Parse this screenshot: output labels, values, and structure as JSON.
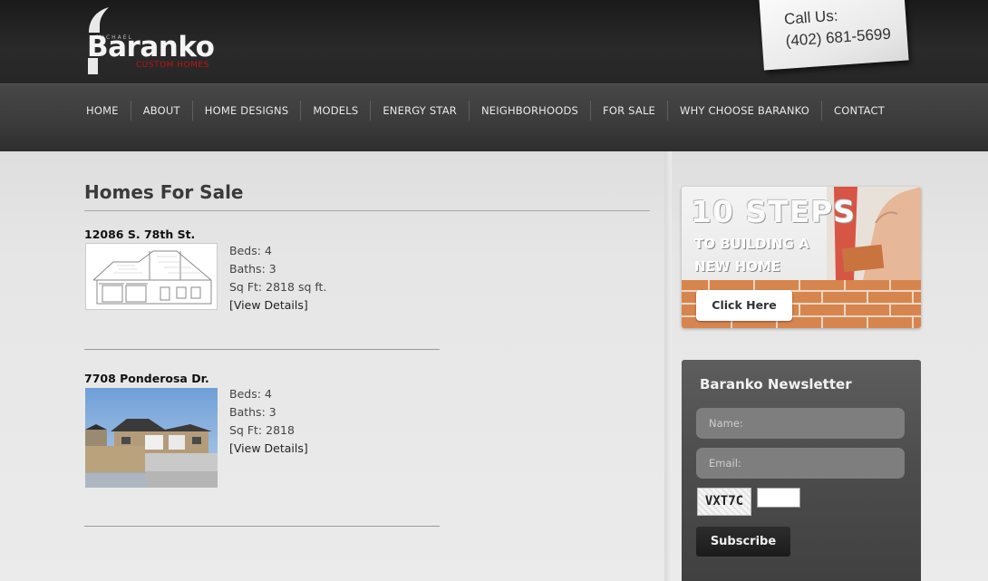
{
  "brand": {
    "name": "Baranko",
    "small_text": "MICHAEL",
    "sub_text": "CUSTOM HOMES",
    "accent_color": "#c21414"
  },
  "callus": {
    "label": "Call Us:",
    "phone": "(402) 681-5699"
  },
  "nav": {
    "items": [
      {
        "label": "HOME"
      },
      {
        "label": "ABOUT"
      },
      {
        "label": "HOME DESIGNS"
      },
      {
        "label": "MODELS"
      },
      {
        "label": "ENERGY STAR"
      },
      {
        "label": "NEIGHBORHOODS"
      },
      {
        "label": "FOR SALE"
      },
      {
        "label": "WHY CHOOSE BARANKO"
      },
      {
        "label": "CONTACT"
      }
    ]
  },
  "main": {
    "title": "Homes For Sale",
    "listings": [
      {
        "address": "12086 S. 78th St.",
        "beds_label": "Beds:",
        "beds": "4",
        "baths_label": "Baths:",
        "baths": "3",
        "sqft_label": "Sq Ft:",
        "sqft": "2818 sq ft.",
        "link": "[View Details]",
        "image_icon": "house-sketch-image"
      },
      {
        "address": "7708 Ponderosa Dr.",
        "beds_label": "Beds:",
        "beds": "4",
        "baths_label": "Baths:",
        "baths": "3",
        "sqft_label": "Sq Ft:",
        "sqft": "2818",
        "link": "[View Details]",
        "image_icon": "house-photo-image"
      }
    ]
  },
  "sidebar": {
    "banner": {
      "title": "10 STEPS",
      "line1": "TO BUILDING A",
      "line2": "NEW HOME",
      "button": "Click Here"
    },
    "newsletter": {
      "title": "Baranko Newsletter",
      "name_placeholder": "Name:",
      "email_placeholder": "Email:",
      "captcha": "VXT7C",
      "subscribe": "Subscribe"
    }
  }
}
